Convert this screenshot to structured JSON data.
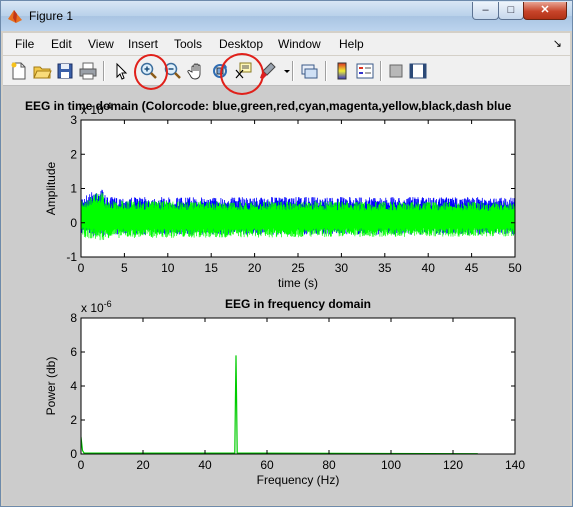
{
  "window": {
    "title": "Figure 1",
    "minimize": "–",
    "maximize": "□",
    "close": "✕"
  },
  "menu": [
    "File",
    "Edit",
    "View",
    "Insert",
    "Tools",
    "Desktop",
    "Window",
    "Help"
  ],
  "toolbar": {
    "icons": [
      "new-figure-icon",
      "open-file-icon",
      "save-icon",
      "print-icon",
      "select-arrow-icon",
      "zoom-in-icon",
      "zoom-out-icon",
      "pan-hand-icon",
      "rotate-3d-icon",
      "data-cursor-icon",
      "brush-icon",
      "link-plot-icon",
      "colorbar-icon",
      "legend-icon",
      "hide-plot-tools-icon",
      "show-plot-tools-icon"
    ]
  },
  "annotations": {
    "circle_color": "#e0201a"
  },
  "chart_data": [
    {
      "type": "line",
      "title": "EEG in time domain (Colorcode: blue,green,red,cyan,magenta,yellow,black,dash blue",
      "xlabel": "time (s)",
      "ylabel": "Amplitude",
      "exponent": "x 10",
      "exponent_power": "-4",
      "xlim": [
        0,
        50
      ],
      "ylim": [
        -1,
        3
      ],
      "xticks": [
        "0",
        "5",
        "10",
        "15",
        "20",
        "25",
        "30",
        "35",
        "40",
        "45",
        "50"
      ],
      "yticks": [
        "-1",
        "0",
        "1",
        "2",
        "3"
      ],
      "series": [
        {
          "color": "#0000ff",
          "x": [
            0,
            2.3,
            3,
            50
          ],
          "upper": [
            0.75,
            1.05,
            0.75,
            0.75
          ],
          "lower": [
            -0.35,
            -0.45,
            -0.35,
            -0.35
          ]
        },
        {
          "color": "#00ff00",
          "x": [
            0,
            2.3,
            3,
            50
          ],
          "upper": [
            0.65,
            0.95,
            0.65,
            0.6
          ],
          "lower": [
            -0.4,
            -0.55,
            -0.45,
            -0.4
          ]
        }
      ]
    },
    {
      "type": "line",
      "title": "EEG in frequency domain",
      "xlabel": "Frequency (Hz)",
      "ylabel": "Power (db)",
      "exponent": "x 10",
      "exponent_power": "-6",
      "xlim": [
        0,
        140
      ],
      "ylim": [
        0,
        8
      ],
      "xticks": [
        "0",
        "20",
        "40",
        "60",
        "80",
        "100",
        "120",
        "140"
      ],
      "yticks": [
        "0",
        "2",
        "4",
        "6",
        "8"
      ],
      "series": [
        {
          "color": "#00cc00",
          "x": [
            0,
            0.5,
            1,
            49.6,
            49.8,
            50,
            50.2,
            50.4,
            128
          ],
          "y": [
            1.0,
            0.2,
            0.05,
            0.05,
            3.1,
            5.8,
            3.1,
            0.05,
            0.02
          ]
        }
      ]
    }
  ]
}
